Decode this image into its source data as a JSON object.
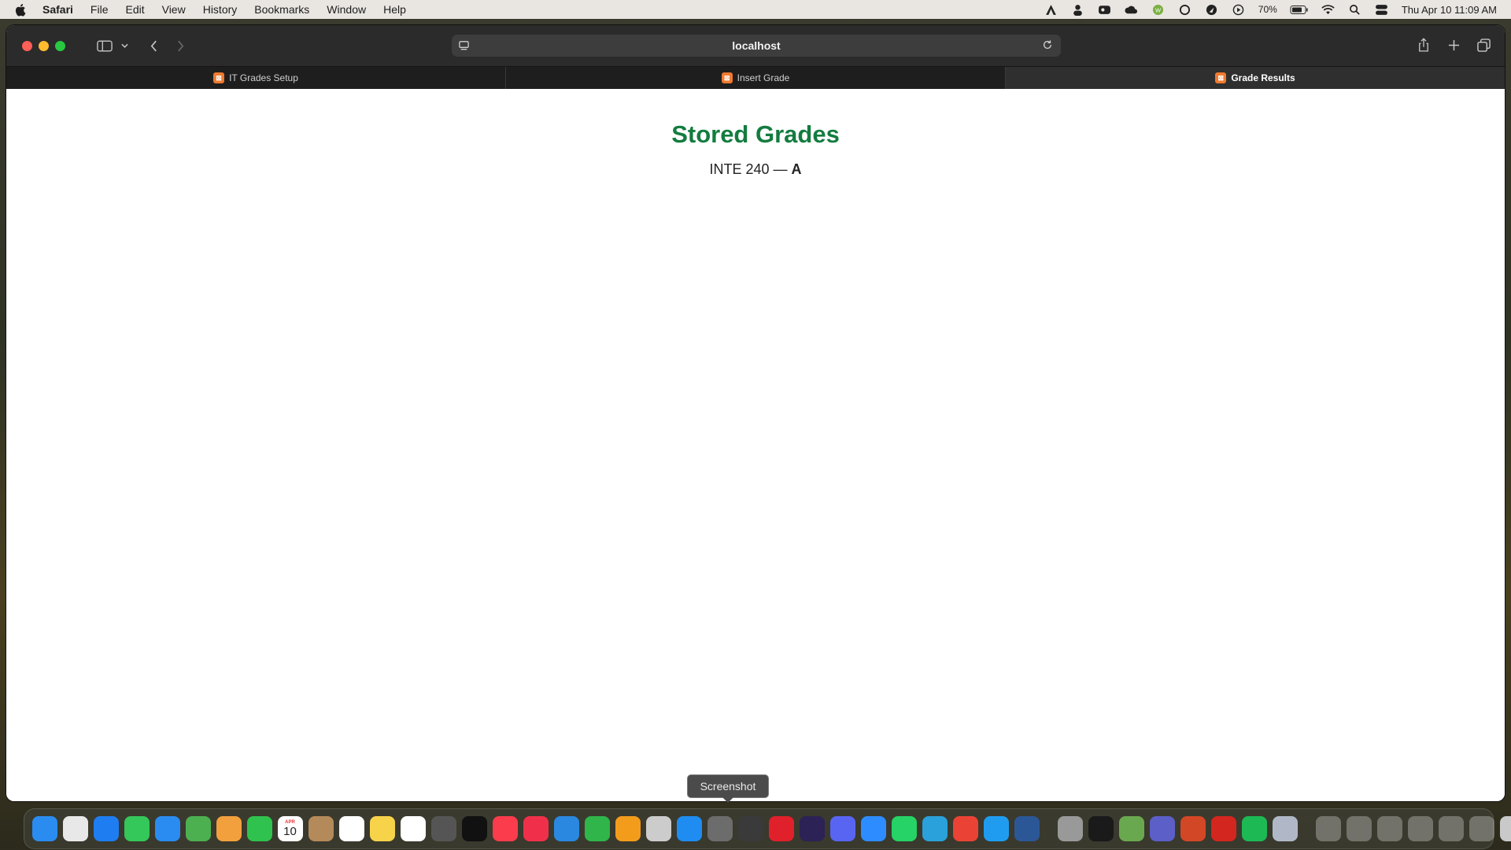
{
  "menubar": {
    "app_name": "Safari",
    "items": [
      "File",
      "Edit",
      "View",
      "History",
      "Bookmarks",
      "Window",
      "Help"
    ],
    "battery": "70%",
    "datetime": "Thu Apr 10  11:09 AM"
  },
  "browser": {
    "url": "localhost",
    "tabs": [
      {
        "label": "IT Grades Setup",
        "active": false
      },
      {
        "label": "Insert Grade",
        "active": false
      },
      {
        "label": "Grade Results",
        "active": true
      }
    ]
  },
  "page": {
    "title": "Stored Grades",
    "course": "INTE 240",
    "separator": " — ",
    "grade": "A"
  },
  "tooltip": {
    "label": "Screenshot"
  },
  "dock": {
    "calendar_day": "10",
    "calendar_month": "APR",
    "apps": [
      {
        "name": "finder-icon",
        "color": "#2a8cf0"
      },
      {
        "name": "launchpad-icon",
        "color": "#e8e8e8"
      },
      {
        "name": "safari-icon",
        "color": "#1e7df0"
      },
      {
        "name": "messages-icon",
        "color": "#34c759"
      },
      {
        "name": "mail-icon",
        "color": "#2a8cf0"
      },
      {
        "name": "maps-icon",
        "color": "#4cb050"
      },
      {
        "name": "photos-icon",
        "color": "#f2a03d"
      },
      {
        "name": "facetime-icon",
        "color": "#2fc24e"
      },
      {
        "name": "calendar-icon",
        "color": "#ffffff"
      },
      {
        "name": "contacts-icon",
        "color": "#b58a5a"
      },
      {
        "name": "reminders-icon",
        "color": "#ffffff"
      },
      {
        "name": "notes-icon",
        "color": "#f7d34a"
      },
      {
        "name": "freeform-icon",
        "color": "#ffffff"
      },
      {
        "name": "calculator-icon",
        "color": "#555555"
      },
      {
        "name": "tv-icon",
        "color": "#111111"
      },
      {
        "name": "music-icon",
        "color": "#fa3c4c"
      },
      {
        "name": "news-icon",
        "color": "#f0304a"
      },
      {
        "name": "keynote-icon",
        "color": "#2a88e0"
      },
      {
        "name": "numbers-icon",
        "color": "#2fb54a"
      },
      {
        "name": "pages-icon",
        "color": "#f39c1c"
      },
      {
        "name": "xcode-stylus-icon",
        "color": "#cccccc"
      },
      {
        "name": "app-store-icon",
        "color": "#1e8cf0"
      },
      {
        "name": "system-settings-icon",
        "color": "#6c6c6c"
      },
      {
        "name": "screenshot-icon",
        "color": "#3a3a3a"
      },
      {
        "name": "opera-icon",
        "color": "#e0202a"
      },
      {
        "name": "eclipse-icon",
        "color": "#2c2255"
      },
      {
        "name": "discord-icon",
        "color": "#5865f2"
      },
      {
        "name": "zoom-icon",
        "color": "#2d8cff"
      },
      {
        "name": "whatsapp-icon",
        "color": "#25d366"
      },
      {
        "name": "telegram-icon",
        "color": "#2aa1da"
      },
      {
        "name": "chrome-icon",
        "color": "#ea4335"
      },
      {
        "name": "vscode-icon",
        "color": "#1f9cf0"
      },
      {
        "name": "word-icon",
        "color": "#2b5797"
      }
    ],
    "apps_right": [
      {
        "name": "quill-icon",
        "color": "#999999"
      },
      {
        "name": "terminal-icon",
        "color": "#1a1a1a"
      },
      {
        "name": "webex-icon",
        "color": "#6aa84f"
      },
      {
        "name": "teams-icon",
        "color": "#5b5fc7"
      },
      {
        "name": "powerpoint-icon",
        "color": "#d24726"
      },
      {
        "name": "acrobat-icon",
        "color": "#d3261e"
      },
      {
        "name": "spotify-icon",
        "color": "#1db954"
      },
      {
        "name": "utility-icon",
        "color": "#b0b8c8"
      }
    ]
  }
}
